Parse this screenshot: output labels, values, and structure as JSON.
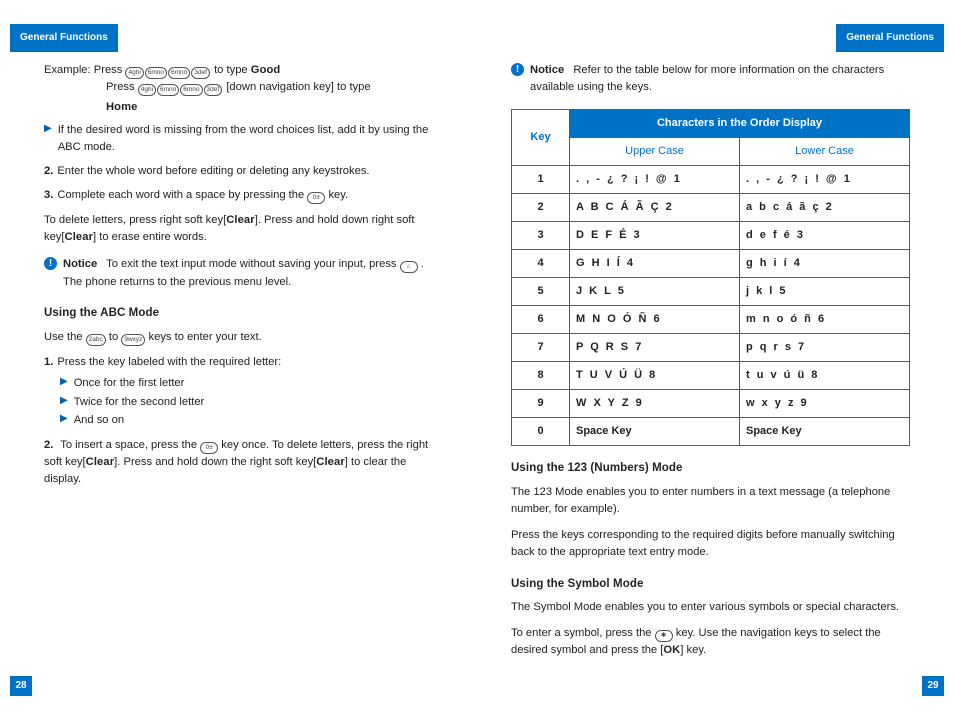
{
  "headers": {
    "left_tab": "General Functions",
    "right_tab": "General Functions",
    "page_left": "28",
    "page_right": "29"
  },
  "left": {
    "ex_label": "Example:",
    "ex1a": "Press",
    "ex1b": "to type",
    "ex1word": "Good",
    "ex2a": "Press",
    "ex2b": "[down navigation key] to type",
    "ex2word": "Home",
    "ex_keys1": [
      "4ghi",
      "6mno",
      "6mno",
      "3def"
    ],
    "ex_keys2": [
      "4ghi",
      "6mno",
      "6mno",
      "3def"
    ],
    "bullet_missing": "If the desired word is missing from the word choices list, add it by using the ABC mode.",
    "step2": "Enter the whole word before editing or deleting any keystrokes.",
    "step3a": "Complete each word with a space by pressing the",
    "step3key": "0±",
    "step3b": "key.",
    "delete": "To delete letters, press right soft key[",
    "clear": "Clear",
    "delete_b": "]. Press and hold down right soft key[",
    "delete_c": "] to erase entire words.",
    "notice1_a": "To exit the text input mode without saving your input, press",
    "notice1_key": "⌂",
    "notice1_b": ". The phone returns to the previous menu level.",
    "abc_heading": "Using the ABC Mode",
    "abc_intro_a": "Use the",
    "abc_key1": "2abc",
    "abc_intro_to": "to",
    "abc_key2": "9wxyz",
    "abc_intro_b": "keys to enter your text.",
    "abc_step1": "Press the key labeled with the required letter:",
    "abc_sub": [
      "Once for the first letter",
      "Twice for the second letter",
      "And so on"
    ],
    "abc_step2_a": "To insert a space, press the",
    "abc_step2_key": "0±",
    "abc_step2_b": "key once. To delete letters, press the right soft key[",
    "abc_step2_c": "]. Press and hold down the right soft key[",
    "abc_step2_d": "] to clear the display."
  },
  "right": {
    "notice_text": "Refer to the table below for more information on the characters available using the keys.",
    "table": {
      "key_header": "Key",
      "title": "Characters in the Order Display",
      "upper": "Upper Case",
      "lower": "Lower Case",
      "rows": [
        {
          "k": "1",
          "u": ". , - ¿ ? ¡ ! @ 1",
          "l": ". , - ¿ ? ¡ ! @ 1"
        },
        {
          "k": "2",
          "u": "A B C Á Ã Ç 2",
          "l": "a b c á ã ç 2"
        },
        {
          "k": "3",
          "u": "D E F É 3",
          "l": "d e f é 3"
        },
        {
          "k": "4",
          "u": "G H I Í 4",
          "l": "g h i í 4"
        },
        {
          "k": "5",
          "u": "J K L 5",
          "l": "j k l 5"
        },
        {
          "k": "6",
          "u": "M N O Ó Ñ 6",
          "l": "m n o ó ñ 6"
        },
        {
          "k": "7",
          "u": "P Q R S 7",
          "l": "p q r s 7"
        },
        {
          "k": "8",
          "u": "T U V Ú Ü 8",
          "l": "t u v ú ü 8"
        },
        {
          "k": "9",
          "u": "W X Y Z 9",
          "l": "w x y z 9"
        },
        {
          "k": "0",
          "u": "Space Key",
          "l": "Space Key"
        }
      ]
    },
    "num_heading": "Using the 123 (Numbers) Mode",
    "num_p1": "The 123 Mode enables you to enter numbers in a text message (a telephone number, for example).",
    "num_p2": "Press the keys corresponding to the required digits before manually switching back to the appropriate text entry mode.",
    "sym_heading": "Using the Symbol Mode",
    "sym_p1": "The Symbol Mode enables you to enter various symbols or special characters.",
    "sym_p2a": "To enter a symbol, press the",
    "sym_key": "✱",
    "sym_p2b": "key. Use the navigation keys to select the desired symbol and press the [",
    "ok": "OK",
    "sym_p2c": "] key."
  },
  "labels": {
    "notice": "Notice"
  }
}
